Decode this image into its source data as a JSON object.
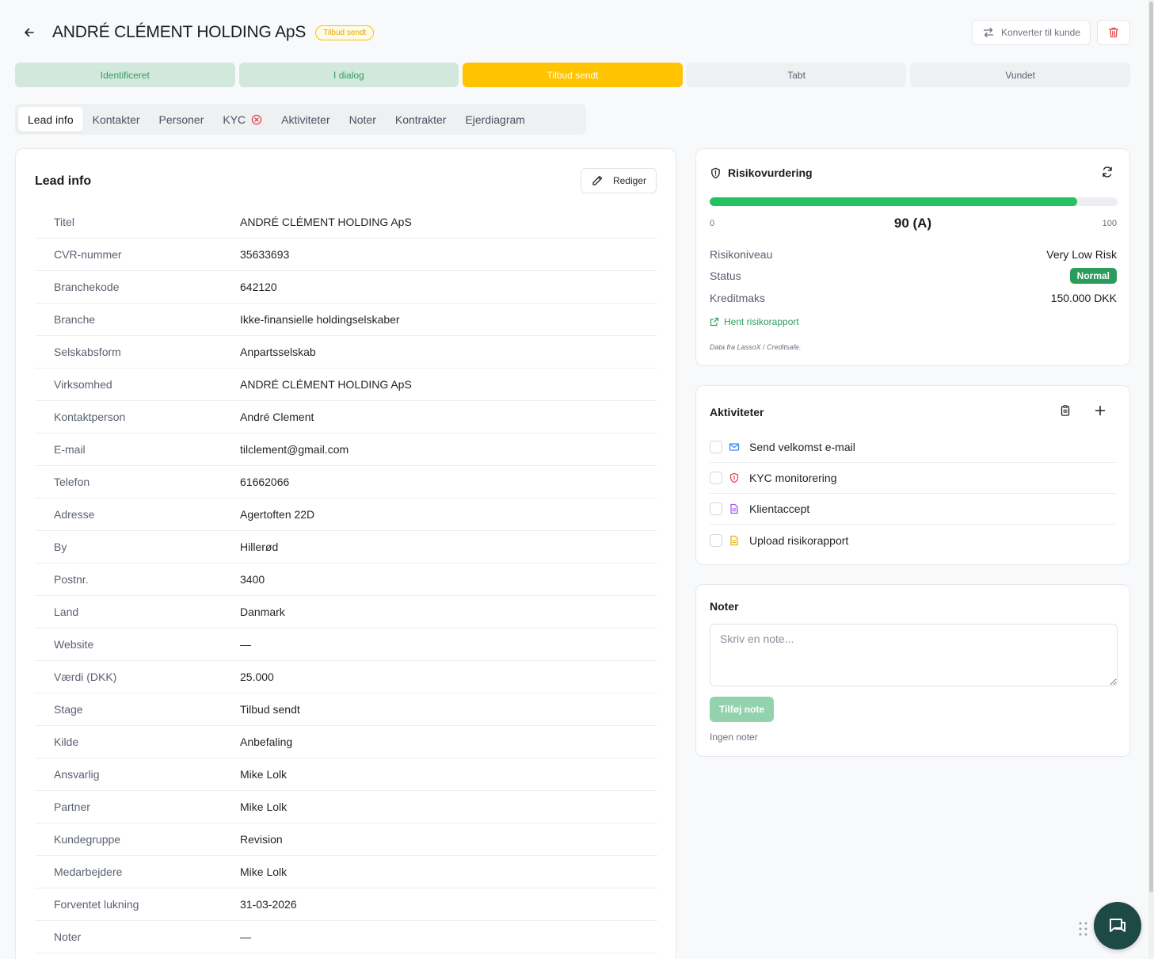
{
  "header": {
    "title": "ANDRÉ CLÉMENT HOLDING ApS",
    "badge": "Tilbud sendt",
    "convert_label": "Konverter til kunde"
  },
  "pipeline": [
    {
      "label": "Identificeret",
      "state": "done"
    },
    {
      "label": "I dialog",
      "state": "done"
    },
    {
      "label": "Tilbud sendt",
      "state": "active"
    },
    {
      "label": "Tabt",
      "state": "todo"
    },
    {
      "label": "Vundet",
      "state": "todo"
    }
  ],
  "tabs": [
    "Lead info",
    "Kontakter",
    "Personer",
    "KYC",
    "Aktiviteter",
    "Noter",
    "Kontrakter",
    "Ejerdiagram"
  ],
  "lead_info": {
    "title": "Lead info",
    "edit_label": "Rediger",
    "rows": [
      {
        "label": "Titel",
        "value": "ANDRÉ CLÉMENT HOLDING ApS"
      },
      {
        "label": "CVR-nummer",
        "value": "35633693"
      },
      {
        "label": "Branchekode",
        "value": "642120"
      },
      {
        "label": "Branche",
        "value": "Ikke-finansielle holdingselskaber"
      },
      {
        "label": "Selskabsform",
        "value": "Anpartsselskab"
      },
      {
        "label": "Virksomhed",
        "value": "ANDRÉ CLÉMENT HOLDING ApS"
      },
      {
        "label": "Kontaktperson",
        "value": "André Clement"
      },
      {
        "label": "E-mail",
        "value": "tilclement@gmail.com"
      },
      {
        "label": "Telefon",
        "value": "61662066"
      },
      {
        "label": "Adresse",
        "value": "Agertoften 22D"
      },
      {
        "label": "By",
        "value": "Hillerød"
      },
      {
        "label": "Postnr.",
        "value": "3400"
      },
      {
        "label": "Land",
        "value": "Danmark"
      },
      {
        "label": "Website",
        "value": "—"
      },
      {
        "label": "Værdi (DKK)",
        "value": "25.000"
      },
      {
        "label": "Stage",
        "value": "Tilbud sendt"
      },
      {
        "label": "Kilde",
        "value": "Anbefaling"
      },
      {
        "label": "Ansvarlig",
        "value": "Mike Lolk"
      },
      {
        "label": "Partner",
        "value": "Mike Lolk"
      },
      {
        "label": "Kundegruppe",
        "value": "Revision"
      },
      {
        "label": "Medarbejdere",
        "value": "Mike Lolk"
      },
      {
        "label": "Forventet lukning",
        "value": "31-03-2026"
      },
      {
        "label": "Noter",
        "value": "—"
      }
    ]
  },
  "risk": {
    "title": "Risikovurdering",
    "score_fraction": 0.9,
    "scale_min": "0",
    "scale_max": "100",
    "score": "90 (A)",
    "level_label": "Risikoniveau",
    "level_value": "Very Low Risk",
    "status_label": "Status",
    "status_value": "Normal",
    "credit_label": "Kreditmaks",
    "credit_value": "150.000 DKK",
    "report_link": "Hent risikorapport",
    "source": "Data fra LassoX / Creditsafe."
  },
  "activities": {
    "title": "Aktiviteter",
    "items": [
      {
        "label": "Send velkomst e-mail",
        "icon": "mail-icon",
        "color": "#3b82f6"
      },
      {
        "label": "KYC monitorering",
        "icon": "shield-alert-icon",
        "color": "#e5484d"
      },
      {
        "label": "Klientaccept",
        "icon": "file-icon",
        "color": "#a855f7"
      },
      {
        "label": "Upload risikorapport",
        "icon": "file-icon",
        "color": "#eab308"
      }
    ]
  },
  "notes": {
    "title": "Noter",
    "placeholder": "Skriv en note...",
    "add_label": "Tilføj note",
    "empty": "Ingen noter"
  }
}
